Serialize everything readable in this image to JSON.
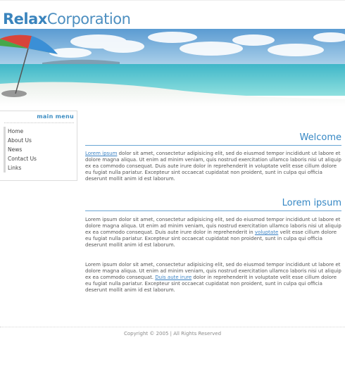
{
  "logo": {
    "bold": "Relax",
    "rest": "Corporation"
  },
  "sidebar": {
    "title": "main menu",
    "items": [
      {
        "label": "Home"
      },
      {
        "label": "About Us"
      },
      {
        "label": "News"
      },
      {
        "label": "Contact Us"
      },
      {
        "label": "Links"
      }
    ]
  },
  "sections": [
    {
      "heading": "Welcome",
      "paragraphs": [
        {
          "link": "Lorem ipsum",
          "after": " dolor sit amet, consectetur adipisicing elit, sed do eiusmod tempor incididunt ut labore et dolore magna aliqua. Ut enim ad minim veniam, quis nostrud exercitation ullamco laboris nisi ut aliquip ex ea commodo consequat. Duis aute irure dolor in reprehenderit in voluptate velit esse cillum dolore eu fugiat nulla pariatur. Excepteur sint occaecat cupidatat non proident, sunt in culpa qui officia deserunt mollit anim id est laborum."
        }
      ]
    },
    {
      "heading": "Lorem ipsum",
      "paragraphs": [
        {
          "before": "Lorem ipsum dolor sit amet, consectetur adipisicing elit, sed do eiusmod tempor incididunt ut labore et dolore magna aliqua. Ut enim ad minim veniam, quis nostrud exercitation ullamco laboris nisi ut aliquip ex ea commodo consequat. Duis aute irure dolor in reprehenderit in ",
          "link": "voluptate",
          "after": " velit esse cillum dolore eu fugiat nulla pariatur. Excepteur sint occaecat cupidatat non proident, sunt in culpa qui officia deserunt mollit anim id est laborum."
        },
        {
          "before": "Lorem ipsum dolor sit amet, consectetur adipisicing elit, sed do eiusmod tempor incididunt ut labore et dolore magna aliqua. Ut enim ad minim veniam, quis nostrud exercitation ullamco laboris nisi ut aliquip ex ea commodo consequat. ",
          "link": "Duis aute irure",
          "after": " dolor in reprehenderit in voluptate velit esse cillum dolore eu fugiat nulla pariatur. Excepteur sint occaecat cupidatat non proident, sunt in culpa qui officia deserunt mollit anim id est laborum."
        }
      ]
    }
  ],
  "footer": {
    "text": "Copyright © 2005 | All Rights Reserved"
  },
  "colors": {
    "accent": "#3587c4",
    "text": "#555555",
    "sea": "#59c8cf",
    "sky": "#6fa8d6"
  }
}
